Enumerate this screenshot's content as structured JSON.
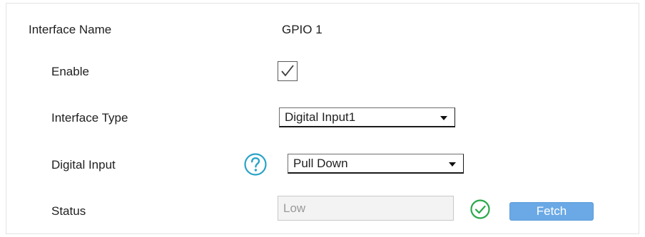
{
  "form": {
    "interface_name": {
      "label": "Interface Name",
      "value": "GPIO 1"
    },
    "enable": {
      "label": "Enable",
      "checked": true
    },
    "interface_type": {
      "label": "Interface Type",
      "selected": "Digital Input1"
    },
    "digital_input": {
      "label": "Digital Input",
      "selected": "Pull Down",
      "help_icon": "question-circle-icon"
    },
    "status": {
      "label": "Status",
      "value": "Low",
      "ok_icon": "check-circle-icon",
      "fetch_label": "Fetch"
    }
  },
  "colors": {
    "accent": "#29a3c6",
    "ok": "#2aa84a",
    "button": "#6aa9e6"
  }
}
